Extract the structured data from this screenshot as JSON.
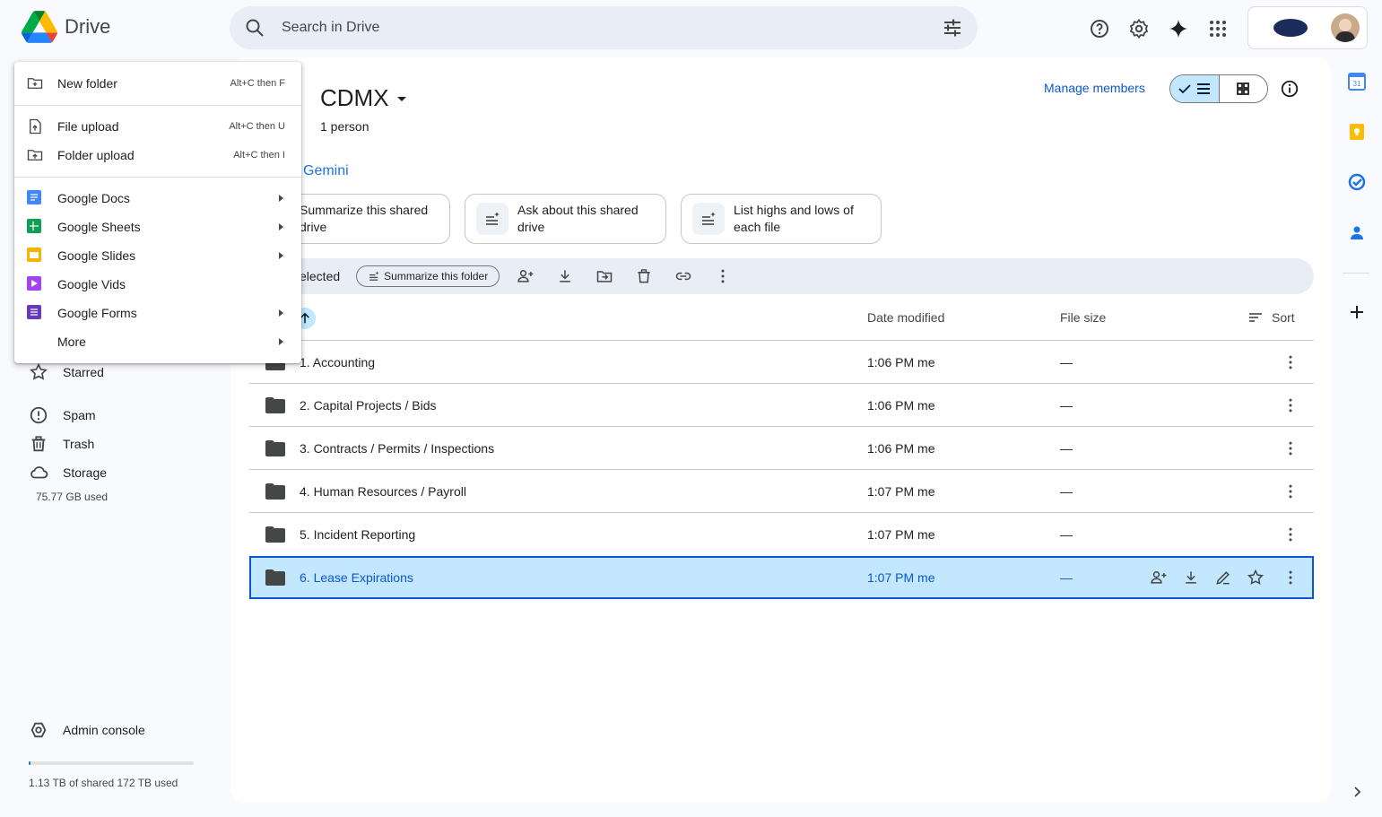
{
  "app": {
    "name": "Drive"
  },
  "search": {
    "placeholder": "Search in Drive"
  },
  "menu": {
    "items": [
      {
        "label": "New folder",
        "shortcut": "Alt+C then F"
      },
      {
        "label": "File upload",
        "shortcut": "Alt+C then U"
      },
      {
        "label": "Folder upload",
        "shortcut": "Alt+C then I"
      },
      {
        "label": "Google Docs"
      },
      {
        "label": "Google Sheets"
      },
      {
        "label": "Google Slides"
      },
      {
        "label": "Google Vids"
      },
      {
        "label": "Google Forms"
      },
      {
        "label": "More"
      }
    ]
  },
  "sidebar": {
    "items": [
      {
        "label": "Starred",
        "icon": "star-icon"
      },
      {
        "label": "Spam",
        "icon": "spam-icon"
      },
      {
        "label": "Trash",
        "icon": "trash-icon"
      },
      {
        "label": "Storage",
        "icon": "cloud-icon"
      }
    ],
    "storage_used": "75.77 GB used",
    "admin_console": "Admin console",
    "shared_storage": "1.13 TB of shared 172 TB used",
    "shared_storage_fraction": 0.0066
  },
  "drive": {
    "title": "CDMX",
    "members": "1 person",
    "manage_members": "Manage members"
  },
  "gemini": {
    "label": "Gemini",
    "chips": [
      {
        "line1": "Summarize this shared",
        "line2": "drive"
      },
      {
        "line1": "Ask about this shared",
        "line2": "drive"
      },
      {
        "line1": "List highs and lows of",
        "line2": "each file"
      }
    ]
  },
  "actionbar": {
    "selected_label": "elected",
    "summarize_folder": "Summarize this folder"
  },
  "table": {
    "columns": {
      "date": "Date modified",
      "size": "File size",
      "sort": "Sort"
    },
    "rows": [
      {
        "name": "1. Accounting",
        "modified": "1:06 PM me",
        "size": "—"
      },
      {
        "name": "2. Capital Projects / Bids",
        "modified": "1:06 PM me",
        "size": "—"
      },
      {
        "name": "3. Contracts / Permits / Inspections",
        "modified": "1:06 PM me",
        "size": "—"
      },
      {
        "name": "4. Human Resources / Payroll",
        "modified": "1:07 PM me",
        "size": "—"
      },
      {
        "name": "5. Incident Reporting",
        "modified": "1:07 PM me",
        "size": "—"
      },
      {
        "name": "6. Lease Expirations",
        "modified": "1:07 PM me",
        "size": "—",
        "selected": true
      }
    ]
  },
  "colors": {
    "accent": "#0b57d0",
    "selected_bg": "#c2e7ff",
    "docs": "#4285f4",
    "sheets": "#0f9d58",
    "slides": "#f4b400",
    "vids": "#a142f4",
    "forms": "#673ab7"
  }
}
